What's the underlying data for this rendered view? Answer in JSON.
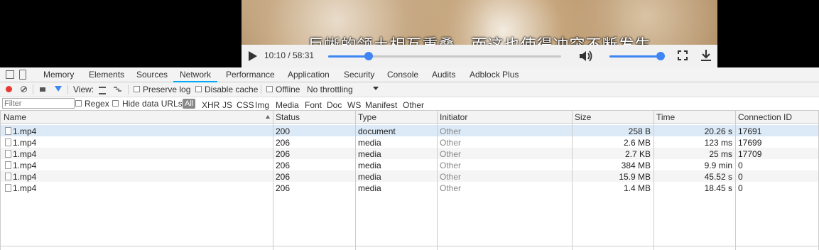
{
  "video": {
    "subtitle": "巨蜥的领土相互重叠，而这也使得冲突不断发生",
    "time": "10:10 / 58:31",
    "seek_progress": 0.174,
    "volume_level": 1.0,
    "accent_color": "#3f86f4"
  },
  "devtools": {
    "tabs": [
      "Memory",
      "Elements",
      "Sources",
      "Network",
      "Performance",
      "Application",
      "Security",
      "Console",
      "Audits",
      "Adblock Plus"
    ],
    "active_tab": "Network",
    "toolbar": {
      "view_label": "View:",
      "preserve_log": "Preserve log",
      "disable_cache": "Disable cache",
      "offline": "Offline",
      "throttling": "No throttling"
    },
    "filter": {
      "placeholder": "Filter",
      "regex": "Regex",
      "hide_data_urls": "Hide data URLs",
      "types": [
        "All",
        "XHR",
        "JS",
        "CSS",
        "Img",
        "Media",
        "Font",
        "Doc",
        "WS",
        "Manifest",
        "Other"
      ]
    },
    "columns": [
      "Name",
      "Status",
      "Type",
      "Initiator",
      "Size",
      "Time",
      "Connection ID"
    ],
    "rows": [
      {
        "name": "1.mp4",
        "status": "200",
        "type": "document",
        "initiator": "Other",
        "size": "258 B",
        "time": "20.26 s",
        "conn": "17691"
      },
      {
        "name": "1.mp4",
        "status": "206",
        "type": "media",
        "initiator": "Other",
        "size": "2.6 MB",
        "time": "123 ms",
        "conn": "17699"
      },
      {
        "name": "1.mp4",
        "status": "206",
        "type": "media",
        "initiator": "Other",
        "size": "2.7 KB",
        "time": "25 ms",
        "conn": "17709"
      },
      {
        "name": "1.mp4",
        "status": "206",
        "type": "media",
        "initiator": "Other",
        "size": "384 MB",
        "time": "9.9 min",
        "conn": "0"
      },
      {
        "name": "1.mp4",
        "status": "206",
        "type": "media",
        "initiator": "Other",
        "size": "15.9 MB",
        "time": "45.52 s",
        "conn": "0"
      },
      {
        "name": "1.mp4",
        "status": "206",
        "type": "media",
        "initiator": "Other",
        "size": "1.4 MB",
        "time": "18.45 s",
        "conn": "0"
      }
    ]
  }
}
